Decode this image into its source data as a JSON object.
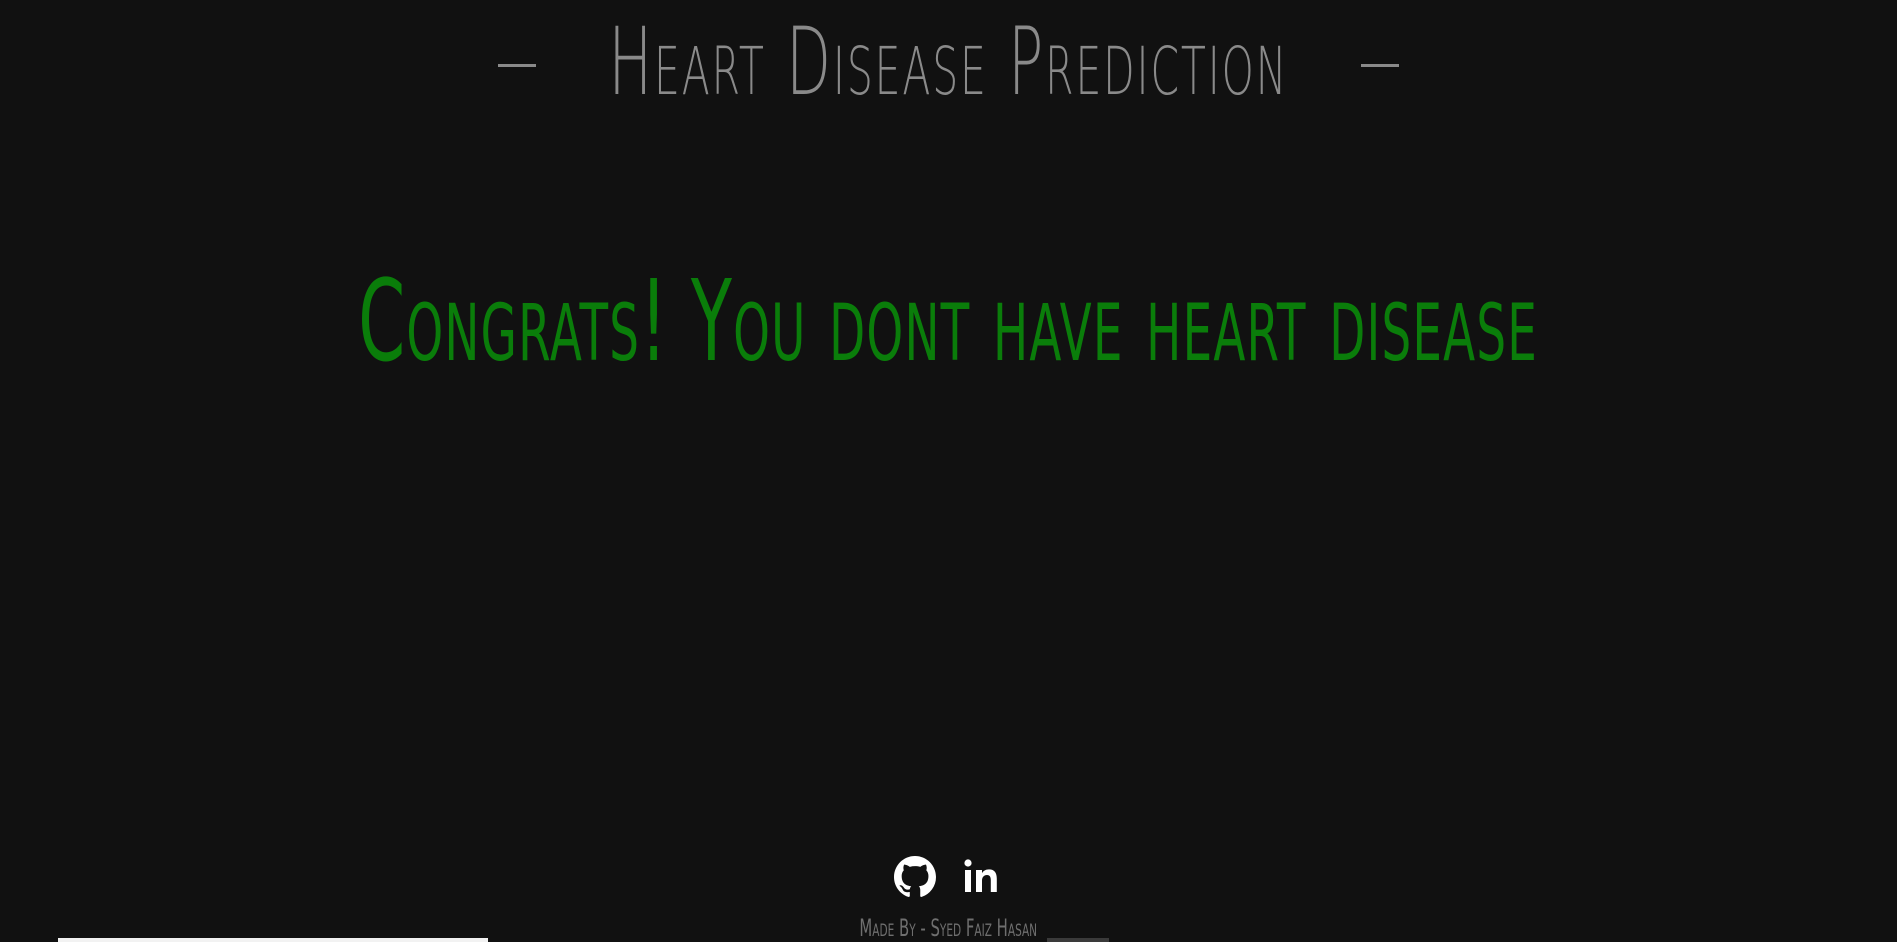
{
  "header": {
    "title": "Heart Disease Prediction"
  },
  "result": {
    "message": "Congrats! You dont have heart disease",
    "color": "#0a7d0a"
  },
  "social": {
    "links": [
      {
        "icon": "github-icon"
      },
      {
        "icon": "linkedin-icon"
      }
    ]
  },
  "footer": {
    "credit": "Made By - Syed Faiz Hasan"
  },
  "colors": {
    "background": "#111111",
    "title": "#8a8a8a",
    "footer": "#6f6f6f",
    "icons": "#ffffff"
  }
}
